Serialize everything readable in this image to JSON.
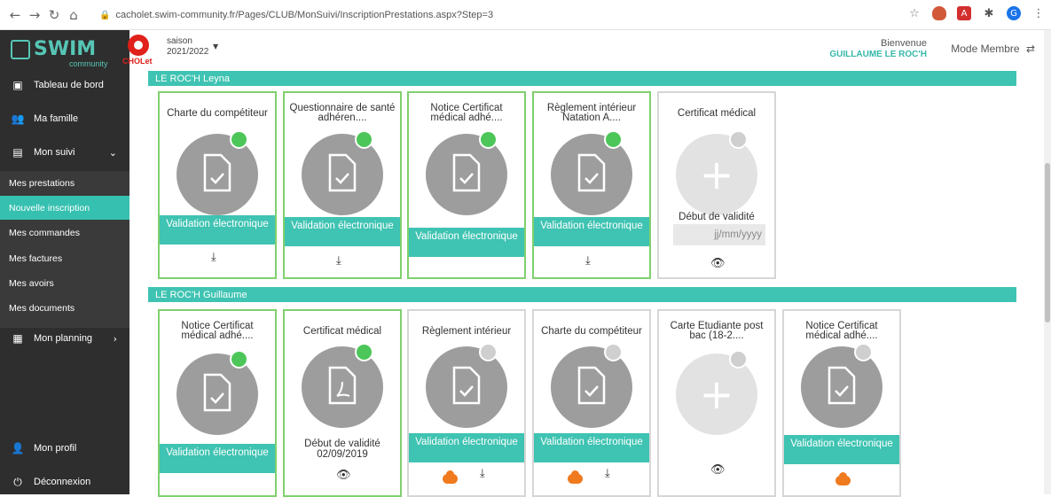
{
  "browser": {
    "url": "cacholet.swim-community.fr/Pages/CLUB/MonSuivi/InscriptionPrestations.aspx?Step=3"
  },
  "sidebar": {
    "logo_text": "SWIM",
    "logo_sub": "community",
    "items": [
      {
        "label": "Tableau de bord",
        "icon": "dashboard-icon"
      },
      {
        "label": "Ma famille",
        "icon": "users-icon"
      },
      {
        "label": "Mon suivi",
        "icon": "clipboard-icon"
      },
      {
        "label": "Mon planning",
        "icon": "calendar-icon"
      },
      {
        "label": "Mon profil",
        "icon": "user-icon"
      },
      {
        "label": "Déconnexion",
        "icon": "power-icon"
      }
    ],
    "submenu": [
      {
        "label": "Mes prestations"
      },
      {
        "label": "Nouvelle inscription"
      },
      {
        "label": "Mes commandes"
      },
      {
        "label": "Mes factures"
      },
      {
        "label": "Mes avoirs"
      },
      {
        "label": "Mes documents"
      }
    ]
  },
  "header": {
    "club_logo_text": "CHOLet",
    "saison_label": "saison",
    "saison_value": "2021/2022",
    "bienvenue": "Bienvenue",
    "user_name": "GUILLAUME LE ROC'H",
    "mode": "Mode Membre"
  },
  "sections": [
    {
      "title": "LE ROC'H Leyna",
      "cards": [
        {
          "title": "Charte du compétiteur",
          "status": "Validation électronique"
        },
        {
          "title": "Questionnaire de santé adhéren....",
          "status": "Validation électronique"
        },
        {
          "title": "Notice Certificat médical adhé....",
          "status": "Validation électronique"
        },
        {
          "title": "Règlement intérieur Natation A....",
          "status": "Validation électronique"
        },
        {
          "title": "Certificat médical",
          "validity_label": "Début de validité",
          "date_placeholder": "jj/mm/yyyy"
        }
      ]
    },
    {
      "title": "LE ROC'H Guillaume",
      "cards": [
        {
          "title": "Notice Certificat médical adhé....",
          "status": "Validation électronique"
        },
        {
          "title": "Certificat médical",
          "validity_label": "Début de validité",
          "validity_date": "02/09/2019"
        },
        {
          "title": "Règlement intérieur",
          "status": "Validation électronique"
        },
        {
          "title": "Charte du compétiteur",
          "status": "Validation électronique"
        },
        {
          "title": "Carte Etudiante post bac (18-2...."
        },
        {
          "title": "Notice Certificat médical adhé....",
          "status": "Validation électronique"
        }
      ]
    }
  ],
  "colors": {
    "accent": "#3fc3b2",
    "ok_dot": "#4dc659",
    "sidebar_bg": "#2e2e2e"
  }
}
